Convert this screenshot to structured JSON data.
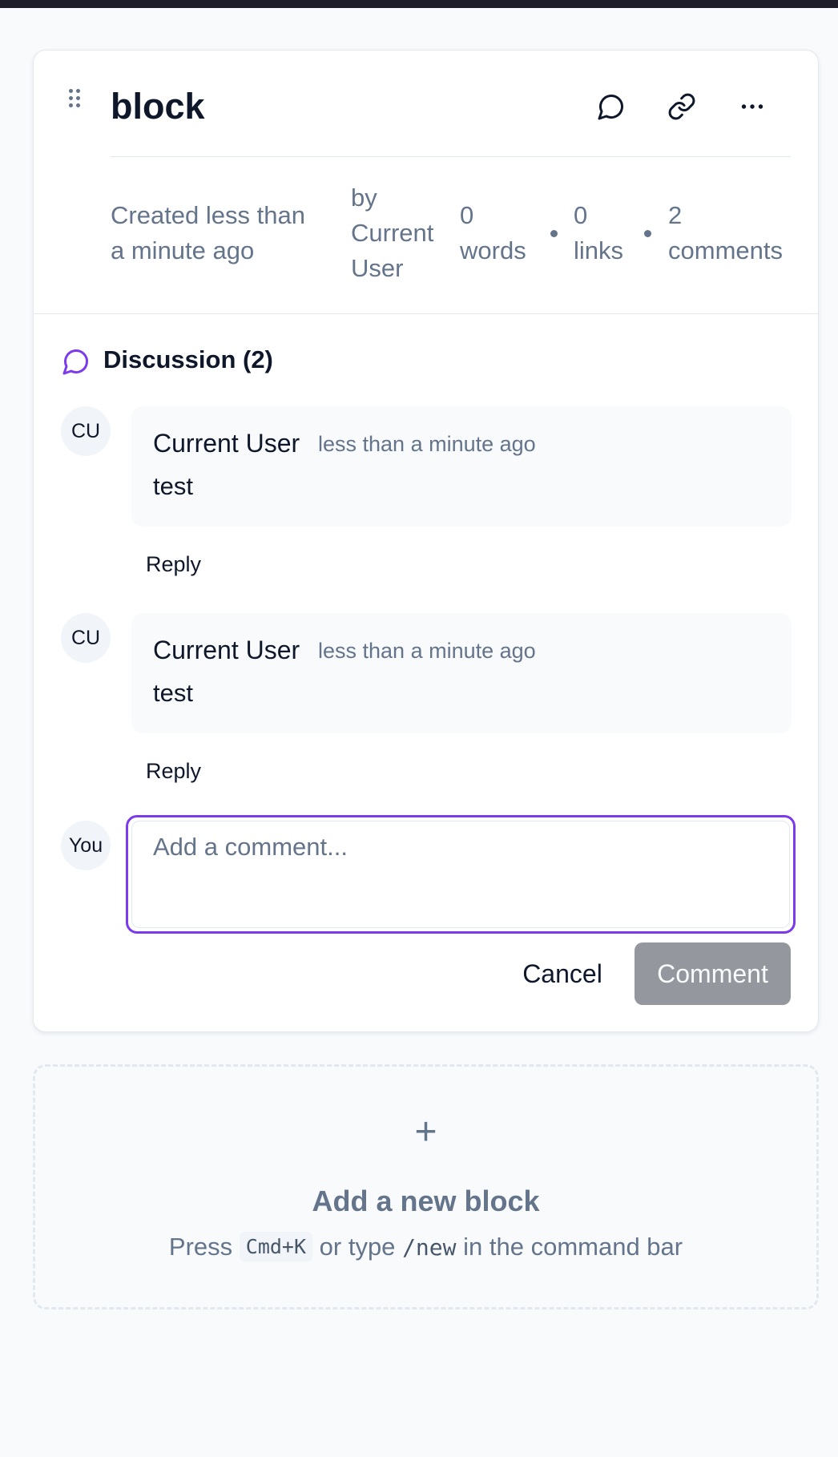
{
  "block": {
    "title": "block",
    "meta": {
      "created_line1": "Created less than",
      "created_line2": "a minute ago",
      "author_line1": "by",
      "author_line2": "Current",
      "author_line3": "User",
      "words_count": "0",
      "words_label": "words",
      "links_count": "0",
      "links_label": "links",
      "comments_count": "2",
      "comments_label": "comments"
    }
  },
  "discussion": {
    "title": "Discussion (2)",
    "comments": [
      {
        "avatar": "CU",
        "author": "Current User",
        "time": "less than a minute ago",
        "body": "test",
        "reply_label": "Reply"
      },
      {
        "avatar": "CU",
        "author": "Current User",
        "time": "less than a minute ago",
        "body": "test",
        "reply_label": "Reply"
      }
    ],
    "composer": {
      "avatar": "You",
      "placeholder": "Add a comment...",
      "value": "",
      "cancel_label": "Cancel",
      "submit_label": "Comment"
    }
  },
  "add_block": {
    "plus": "+",
    "title": "Add a new block",
    "hint_press": "Press",
    "hint_shortcut": "Cmd+K",
    "hint_or_type": "or type",
    "hint_command": "/new",
    "hint_tail": "in the command bar"
  },
  "colors": {
    "accent": "#7c3aed",
    "muted_text": "#64748b",
    "border": "#e2e8f0",
    "button_disabled": "#94979e"
  },
  "icons": {
    "drag": "drag-handle-icon",
    "comment": "comment-icon",
    "link": "link-icon",
    "more": "more-icon",
    "discussion": "discussion-icon"
  }
}
